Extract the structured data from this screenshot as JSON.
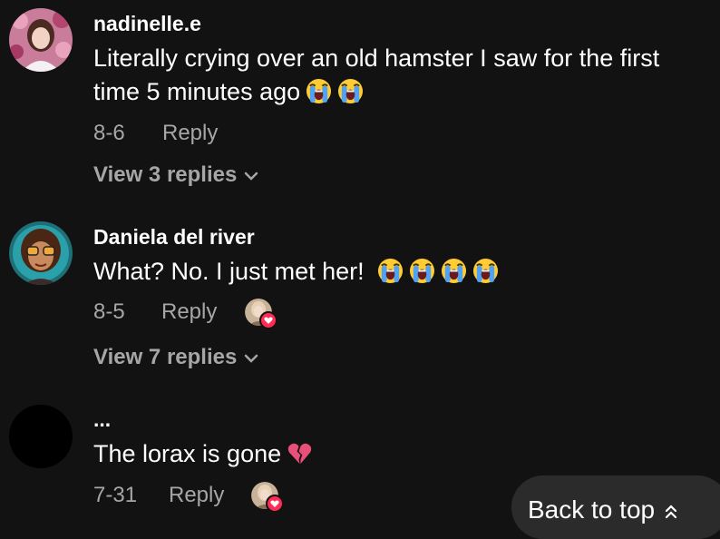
{
  "comments": [
    {
      "username": "nadinelle.e",
      "text": "Literally crying over an old hamster I saw for the first time 5 minutes ago",
      "emoji": [
        "loudly-crying-face",
        "loudly-crying-face"
      ],
      "date": "8-6",
      "reply_label": "Reply",
      "view_replies": "View 3 replies"
    },
    {
      "username": "Daniela del river",
      "text": "What? No. I just met her!",
      "emoji": [
        "loudly-crying-face",
        "loudly-crying-face",
        "loudly-crying-face",
        "loudly-crying-face"
      ],
      "date": "8-5",
      "reply_label": "Reply",
      "view_replies": "View 7 replies",
      "creator_liked": true
    },
    {
      "username": "...",
      "text": "The lorax is gone",
      "emoji": [
        "broken-heart"
      ],
      "date": "7-31",
      "reply_label": "Reply",
      "creator_liked": true
    }
  ],
  "back_to_top": "Back to top",
  "colors": {
    "background": "#121212",
    "muted": "#a6a6a6",
    "accent": "#fe2c55",
    "button": "#2b2b2b"
  }
}
